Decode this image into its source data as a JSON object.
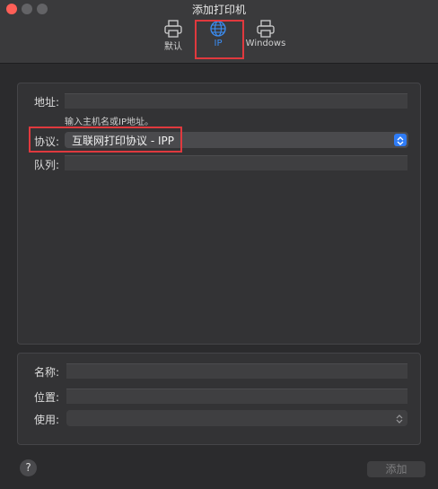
{
  "window": {
    "title": "添加打印机"
  },
  "tabs": [
    {
      "label": "默认",
      "icon": "printer-icon"
    },
    {
      "label": "IP",
      "icon": "globe-icon",
      "selected": true
    },
    {
      "label": "Windows",
      "icon": "printer-icon"
    }
  ],
  "form": {
    "address_label": "地址:",
    "address_value": "",
    "address_hint": "输入主机名或IP地址。",
    "protocol_label": "协议:",
    "protocol_value": "互联网打印协议 - IPP",
    "queue_label": "队列:",
    "queue_value": ""
  },
  "details": {
    "name_label": "名称:",
    "name_value": "",
    "location_label": "位置:",
    "location_value": "",
    "use_label": "使用:",
    "use_value": ""
  },
  "footer": {
    "help_label": "?",
    "add_label": "添加"
  },
  "colors": {
    "accent": "#2f7cf6",
    "highlight_box": "#e0393e"
  }
}
